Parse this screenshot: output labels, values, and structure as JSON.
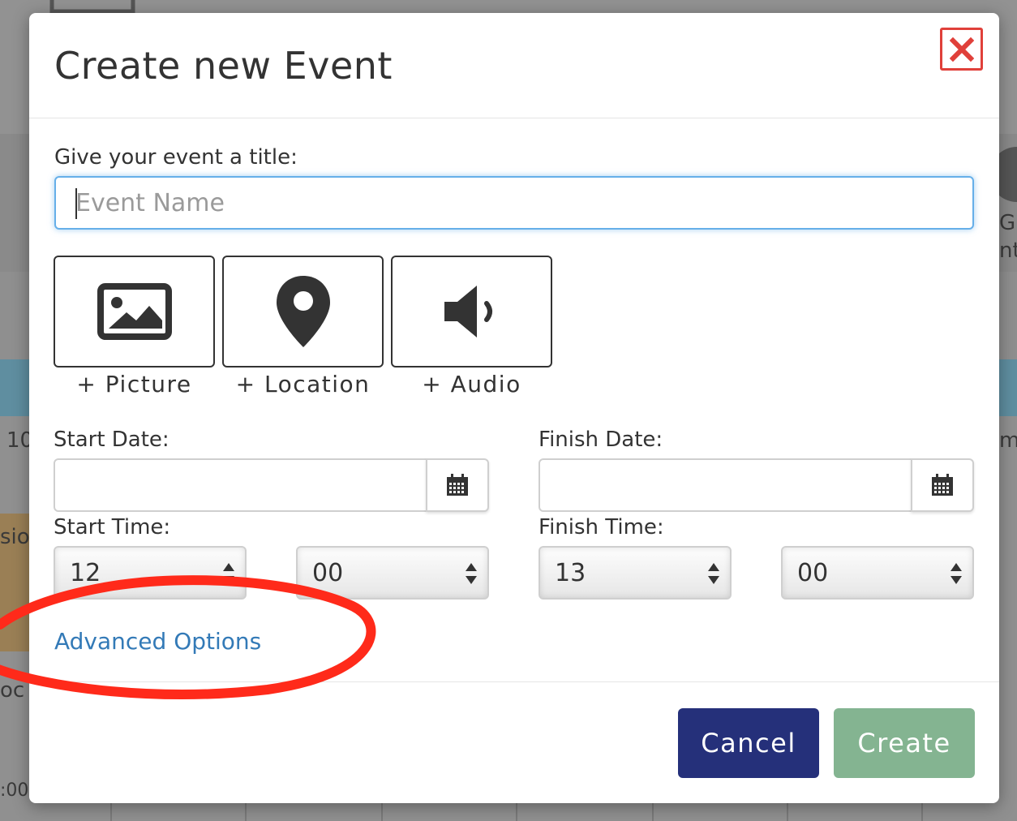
{
  "modal": {
    "title": "Create new Event",
    "close_icon": "close-x-icon",
    "title_label": "Give your event a title:",
    "title_input": {
      "value": "",
      "placeholder": "Event Name"
    },
    "media_buttons": [
      {
        "icon": "picture-icon",
        "label": "+ Picture"
      },
      {
        "icon": "location-pin-icon",
        "label": "+ Location"
      },
      {
        "icon": "audio-speaker-icon",
        "label": "+ Audio"
      }
    ],
    "start_date": {
      "label": "Start Date:",
      "value": "",
      "icon": "calendar-icon"
    },
    "finish_date": {
      "label": "Finish Date:",
      "value": "",
      "icon": "calendar-icon"
    },
    "start_time": {
      "label": "Start Time:",
      "hour": "12",
      "minute": "00"
    },
    "finish_time": {
      "label": "Finish Time:",
      "hour": "13",
      "minute": "00"
    },
    "advanced_link": "Advanced Options",
    "buttons": {
      "cancel": "Cancel",
      "create": "Create"
    }
  },
  "background": {
    "left_fragments": [
      "10",
      "sio",
      "oc",
      ":00"
    ],
    "right_fragments": [
      "Gr",
      "nt",
      "m"
    ]
  },
  "colors": {
    "link": "#337ab7",
    "cancel_bg": "#25307a",
    "create_bg": "#84b491",
    "close_border": "#e0403a",
    "annotation_circle": "#ff2a1a"
  }
}
